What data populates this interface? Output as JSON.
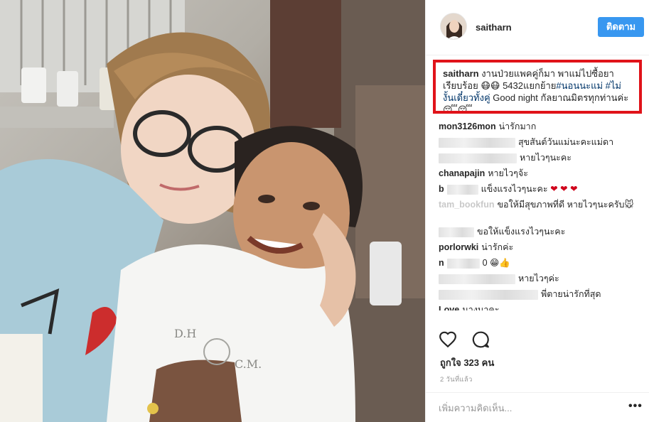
{
  "post": {
    "username": "saitharn",
    "follow_label": "ติดตาม",
    "caption": {
      "user": "saitharn",
      "text_1": "งานป่วยแพคคู่ก็มา พาแม่ไปซื้อยาเรียบร้อย",
      "emoji_1": "😷😷",
      "text_2": "5432แยกย้าย",
      "tag_1": "#นอนนะแม่",
      "tag_2": "#ไม่งั้นเดี๋ยวทั้งคู่",
      "text_3": "Good night กัลยาณมิตรทุกท่านค่ะ",
      "emoji_2": "😴😴"
    },
    "comments": [
      {
        "user": "mon3126mon",
        "text": "น่ารักมาก",
        "blurred": false
      },
      {
        "user": "",
        "text": "สุขสันต์วันแม่นะคะแม่ดา",
        "blurred": true
      },
      {
        "user": "",
        "text": "หายไวๆนะคะ",
        "blurred": true
      },
      {
        "user": "chanapajin",
        "text": "หายไวๆจ้ะ",
        "blurred": false
      },
      {
        "user": "b",
        "text": "แข็งแรงไวๆนะคะ",
        "blurred": true,
        "hearts": "❤ ❤ ❤"
      },
      {
        "user": "tam_bookfun",
        "text": "ขอให้มีสุขภาพที่ดี หายไวๆนะครับ🐭",
        "blurred": false
      },
      {
        "user": "",
        "text": "ขอให้แข็งแรงไวๆนะคะ",
        "blurred": true
      },
      {
        "user": "porlorwki",
        "text": "น่ารักค่ะ",
        "blurred": false
      },
      {
        "user": "n",
        "text": "0 😁👍",
        "blurred": true
      },
      {
        "user": "",
        "text": "หายไวๆค่ะ",
        "blurred": true
      },
      {
        "user": "",
        "text": "พี่ตายน่ารักที่สุด",
        "blurred": true
      },
      {
        "user": "Love",
        "text": "นางนาคะ",
        "blurred": false
      }
    ],
    "likes": "ถูกใจ 323 คน",
    "time_ago": "2 วันที่แล้ว",
    "comment_placeholder": "เพิ่มความคิดเห็น...",
    "more_label": "•••"
  },
  "photo": {
    "shirt_text_1": "D.H",
    "shirt_text_2": "C.M."
  },
  "colors": {
    "accent": "#3897f0",
    "highlight_box": "#e0131a",
    "hashtag": "#003569"
  },
  "icons": [
    "heart-icon",
    "comment-icon",
    "more-options-icon"
  ]
}
